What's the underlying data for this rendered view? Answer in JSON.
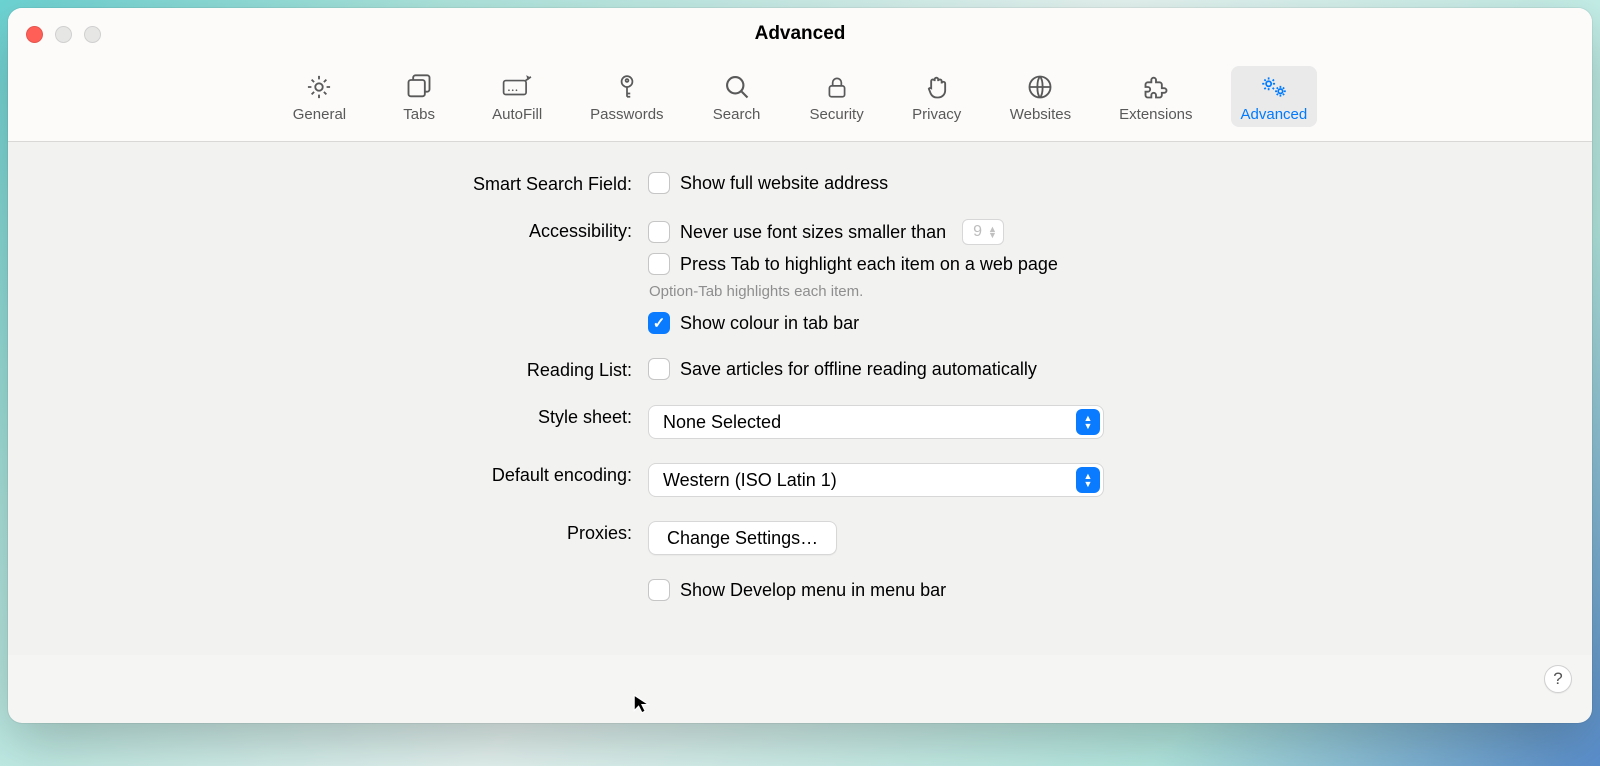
{
  "window": {
    "title": "Advanced"
  },
  "toolbar": {
    "items": [
      {
        "label": "General",
        "icon": "gear-icon",
        "active": false
      },
      {
        "label": "Tabs",
        "icon": "tabs-icon",
        "active": false
      },
      {
        "label": "AutoFill",
        "icon": "autofill-icon",
        "active": false
      },
      {
        "label": "Passwords",
        "icon": "key-icon",
        "active": false
      },
      {
        "label": "Search",
        "icon": "search-icon",
        "active": false
      },
      {
        "label": "Security",
        "icon": "lock-icon",
        "active": false
      },
      {
        "label": "Privacy",
        "icon": "hand-icon",
        "active": false
      },
      {
        "label": "Websites",
        "icon": "globe-icon",
        "active": false
      },
      {
        "label": "Extensions",
        "icon": "puzzle-icon",
        "active": false
      },
      {
        "label": "Advanced",
        "icon": "gears-icon",
        "active": true
      }
    ]
  },
  "sections": {
    "smart_search": {
      "label": "Smart Search Field:",
      "show_full_address": "Show full website address",
      "show_full_address_checked": false
    },
    "accessibility": {
      "label": "Accessibility:",
      "never_font_size": "Never use font sizes smaller than",
      "never_font_size_checked": false,
      "min_font_value": "9",
      "press_tab": "Press Tab to highlight each item on a web page",
      "press_tab_checked": false,
      "press_tab_hint": "Option-Tab highlights each item.",
      "show_colour": "Show colour in tab bar",
      "show_colour_checked": true
    },
    "reading_list": {
      "label": "Reading List:",
      "save_offline": "Save articles for offline reading automatically",
      "save_offline_checked": false
    },
    "style_sheet": {
      "label": "Style sheet:",
      "value": "None Selected"
    },
    "default_encoding": {
      "label": "Default encoding:",
      "value": "Western (ISO Latin 1)"
    },
    "proxies": {
      "label": "Proxies:",
      "button": "Change Settings…"
    },
    "develop": {
      "label": "Show Develop menu in menu bar",
      "checked": false
    }
  }
}
